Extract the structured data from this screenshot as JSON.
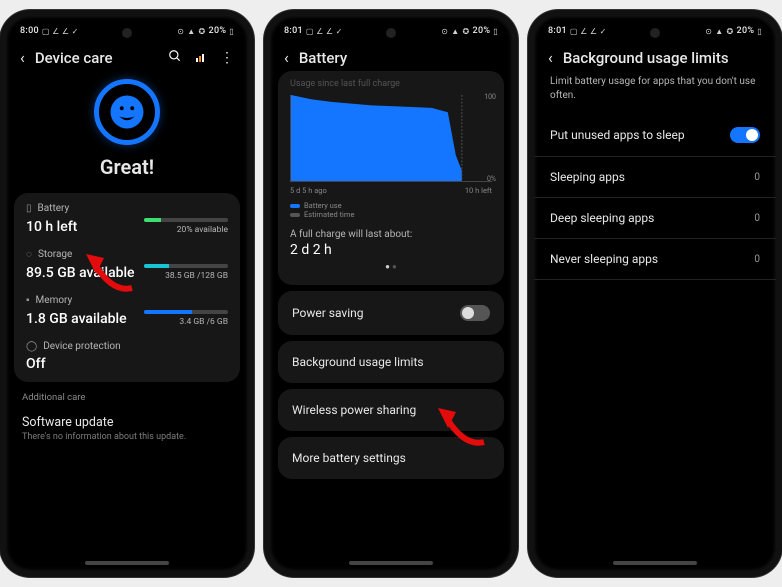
{
  "status": {
    "time1": "8:00",
    "time2": "8:01",
    "time3": "8:01",
    "battery_pct": "20%"
  },
  "screen1": {
    "title": "Device care",
    "hero": "Great!",
    "battery": {
      "label": "Battery",
      "value": "10 h left",
      "pct_text": "20% available",
      "pct": 20,
      "color": "#3de06e"
    },
    "storage": {
      "label": "Storage",
      "value": "89.5 GB available",
      "pct_text": "38.5 GB /128 GB",
      "pct": 30,
      "color": "#17c6d6"
    },
    "memory": {
      "label": "Memory",
      "value": "1.8 GB available",
      "pct_text": "3.4 GB /6 GB",
      "pct": 57,
      "color": "#1476ff"
    },
    "protection": {
      "label": "Device protection",
      "value": "Off"
    },
    "additional_head": "Additional care",
    "update": {
      "title": "Software update",
      "sub": "There's no information about this update."
    }
  },
  "screen2": {
    "title": "Battery",
    "top_truncated": "Usage since last full charge",
    "axis_left": "5 d 5 h ago",
    "axis_right": "10 h left",
    "legend_use": "Battery use",
    "legend_est": "Estimated time",
    "est_label": "A full charge will last about:",
    "est_value": "2 d 2 h",
    "power_saving": "Power saving",
    "bg_limits": "Background usage limits",
    "wireless": "Wireless power sharing",
    "more": "More battery settings"
  },
  "screen3": {
    "title": "Background usage limits",
    "desc": "Limit battery usage for apps that you don't use often.",
    "sleep_toggle": "Put unused apps to sleep",
    "rows": {
      "sleeping": {
        "label": "Sleeping apps",
        "val": "0"
      },
      "deep": {
        "label": "Deep sleeping apps",
        "val": "0"
      },
      "never": {
        "label": "Never sleeping apps",
        "val": "0"
      }
    }
  },
  "chart_data": {
    "type": "area",
    "title": "Battery use / Estimated time",
    "xlabel": "",
    "ylabel": "%",
    "ylim": [
      0,
      100
    ],
    "series": [
      {
        "name": "Battery use",
        "color": "#1476ff",
        "x": [
          0,
          10,
          20,
          30,
          40,
          50,
          60,
          70,
          78,
          80,
          82,
          85,
          100
        ],
        "values": [
          100,
          95,
          92,
          90,
          88,
          87,
          86,
          85,
          80,
          55,
          30,
          12,
          0
        ]
      }
    ],
    "x_annotations": {
      "start": "5 d 5 h ago",
      "end": "10 h left"
    }
  },
  "colors": {
    "accent": "#1476ff",
    "bg_card": "#171717"
  }
}
